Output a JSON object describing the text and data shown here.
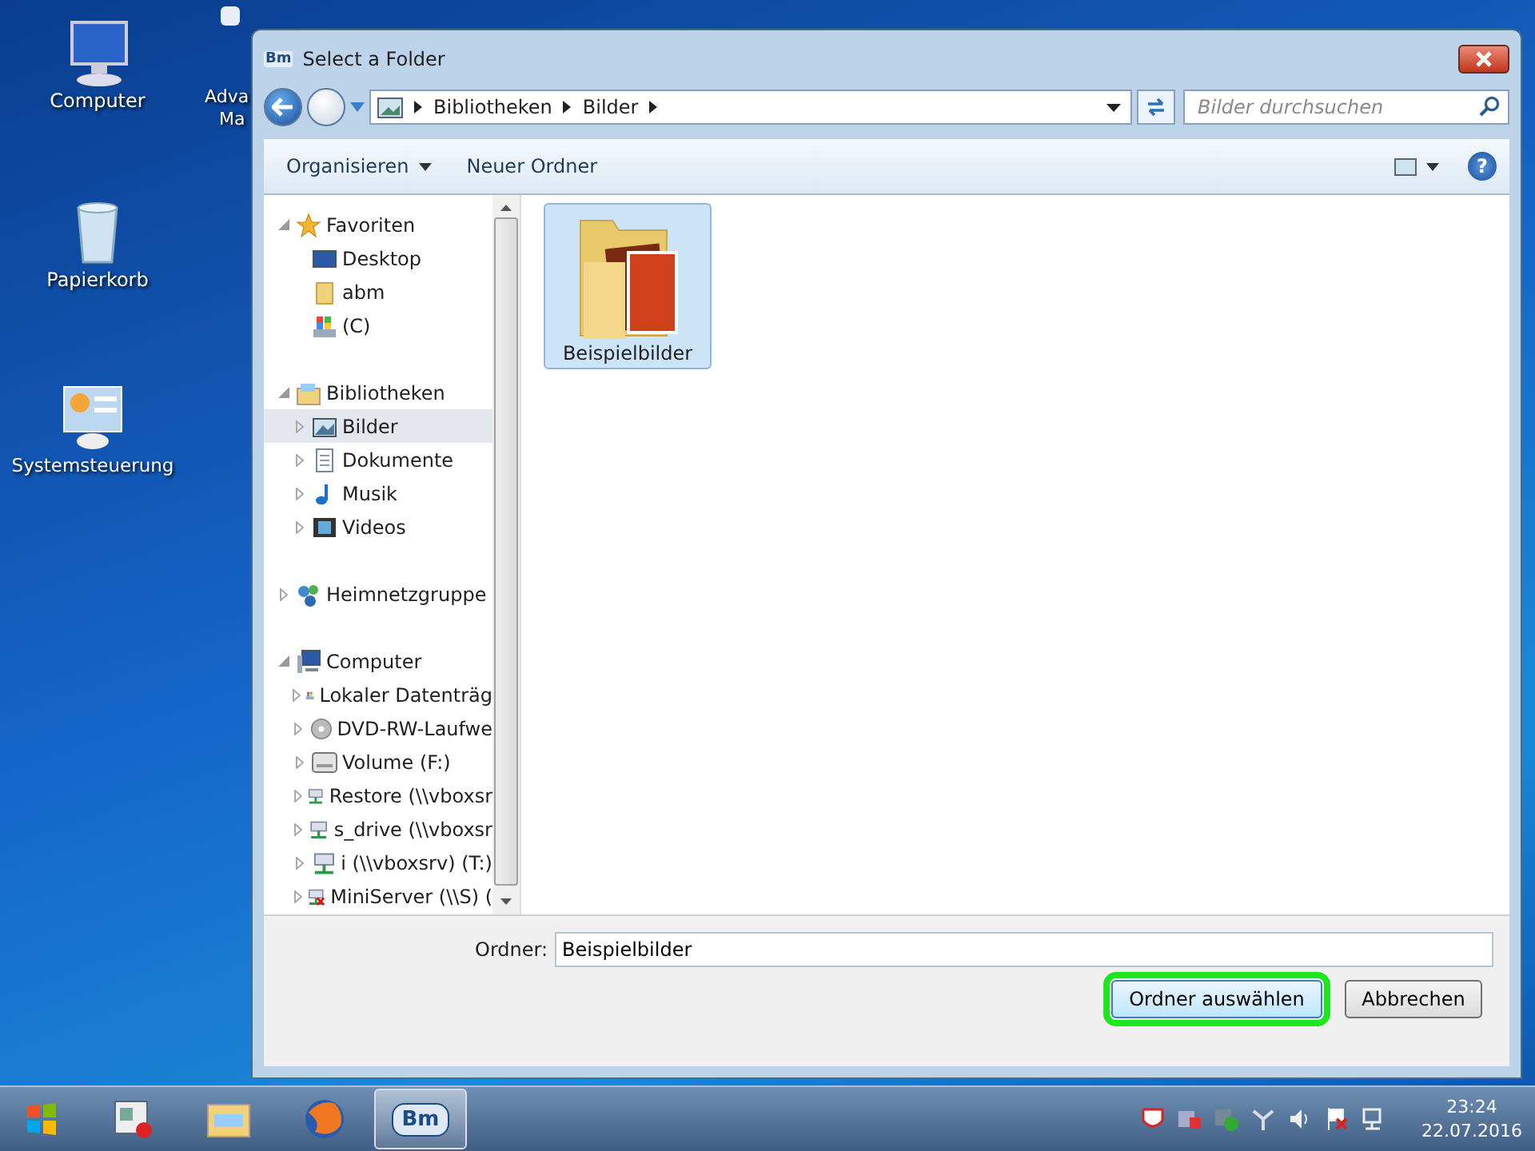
{
  "desktop_icons": [
    {
      "kind": "computer",
      "label": [
        "Computer"
      ]
    },
    {
      "kind": "app",
      "label": [
        "Adva",
        "Ma"
      ]
    },
    {
      "kind": "recycle-bin",
      "label": [
        "Papierkorb"
      ]
    },
    {
      "kind": "control-panel",
      "label": [
        "Systemsteuerung"
      ]
    }
  ],
  "window": {
    "title": "Select a Folder",
    "app_badge": "Bm"
  },
  "address_bar": {
    "crumbs": [
      "Bibliotheken",
      "Bilder"
    ]
  },
  "search": {
    "placeholder": "Bilder durchsuchen"
  },
  "toolbar": {
    "organize": "Organisieren",
    "new_folder": "Neuer Ordner",
    "help": "?"
  },
  "tree": [
    {
      "label": "Favoriten",
      "kind": "star",
      "expanded": true,
      "selected": false,
      "children": [
        {
          "label": "Desktop",
          "kind": "monitor",
          "selected": false
        },
        {
          "label": "abm",
          "kind": "folder",
          "selected": false
        },
        {
          "label": "(C)",
          "kind": "drive",
          "selected": false
        }
      ]
    },
    {
      "label": "Bibliotheken",
      "kind": "library",
      "expanded": true,
      "selected": false,
      "children": [
        {
          "label": "Bilder",
          "kind": "pictures",
          "expanded": false,
          "selected": true
        },
        {
          "label": "Dokumente",
          "kind": "document",
          "expanded": false,
          "selected": false
        },
        {
          "label": "Musik",
          "kind": "music",
          "expanded": false,
          "selected": false
        },
        {
          "label": "Videos",
          "kind": "video",
          "expanded": false,
          "selected": false
        }
      ]
    },
    {
      "label": "Heimnetzgruppe",
      "kind": "homegroup",
      "expanded": false,
      "selected": false
    },
    {
      "label": "Computer",
      "kind": "computer",
      "expanded": true,
      "selected": false,
      "children": [
        {
          "label": "Lokaler Datenträg",
          "kind": "drive",
          "expanded": false,
          "selected": false
        },
        {
          "label": "DVD-RW-Laufwe",
          "kind": "dvd",
          "expanded": false,
          "selected": false
        },
        {
          "label": "Volume (F:)",
          "kind": "disk",
          "expanded": false,
          "selected": false
        },
        {
          "label": "Restore (\\\\vboxsr",
          "kind": "netdrive",
          "expanded": false,
          "selected": false
        },
        {
          "label": "s_drive (\\\\vboxsr",
          "kind": "netdrive",
          "expanded": false,
          "selected": false
        },
        {
          "label": "i (\\\\vboxsrv) (T:)",
          "kind": "netdrive",
          "expanded": false,
          "selected": false
        },
        {
          "label": "MiniServer (\\\\S) (",
          "kind": "netdrive-offline",
          "expanded": false,
          "selected": false
        }
      ]
    }
  ],
  "files": [
    {
      "name": "Beispielbilder",
      "selected": true
    }
  ],
  "folder_field": {
    "label": "Ordner:",
    "value": "Beispielbilder"
  },
  "buttons": [
    {
      "label": "Ordner auswählen",
      "highlighted": true
    },
    {
      "label": "Abbrechen",
      "highlighted": false
    }
  ],
  "taskbar": {
    "tasks": [
      {
        "kind": "app-window",
        "selected": false
      },
      {
        "kind": "explorer",
        "selected": false
      },
      {
        "kind": "browser",
        "selected": false
      },
      {
        "kind": "bm",
        "label": "Bm",
        "selected": true
      }
    ],
    "clock": {
      "time": "23:24",
      "date": "22.07.2016"
    }
  }
}
